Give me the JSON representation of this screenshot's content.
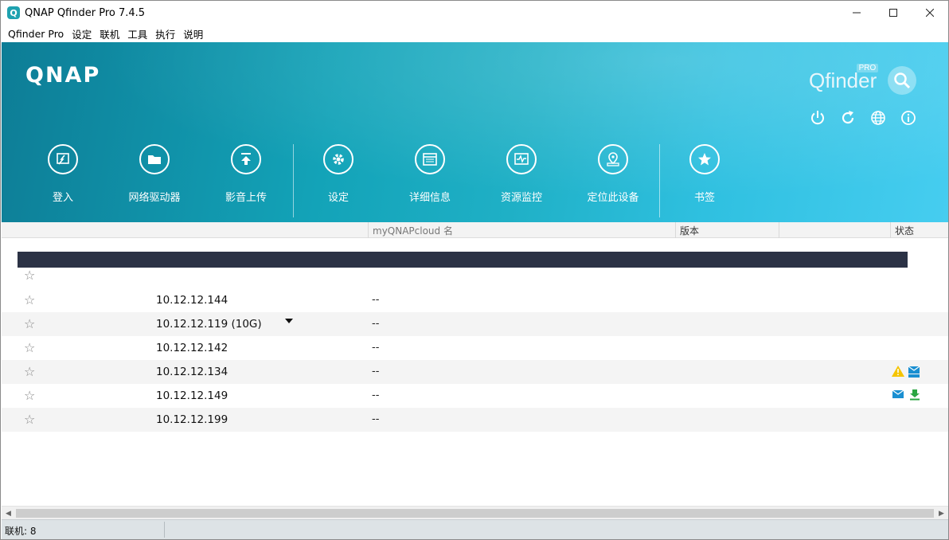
{
  "window": {
    "title": "QNAP Qfinder Pro 7.4.5"
  },
  "menu": [
    "Qfinder Pro",
    "设定",
    "联机",
    "工具",
    "执行",
    "说明"
  ],
  "banner": {
    "logo": "QNAP",
    "brand": "Qfinder",
    "brand_badge": "PRO",
    "toolbar": [
      "登入",
      "网络驱动器",
      "影音上传",
      "设定",
      "详细信息",
      "资源监控",
      "定位此设备",
      "书签"
    ]
  },
  "table": {
    "headers": {
      "cloud": "myQNAPcloud 名",
      "version": "版本",
      "status": "状态"
    },
    "rows": [
      {
        "ip": "10.12.12.144",
        "cloud": "--",
        "has_dropdown": false
      },
      {
        "ip": "10.12.12.119 (10G)",
        "cloud": "--",
        "has_dropdown": true
      },
      {
        "ip": "10.12.12.142",
        "cloud": "--",
        "has_dropdown": false
      },
      {
        "ip": "10.12.12.134",
        "cloud": "--",
        "has_dropdown": false,
        "status_icons": [
          "warning-icon",
          "smtp-icon"
        ]
      },
      {
        "ip": "10.12.12.149",
        "cloud": "--",
        "has_dropdown": false,
        "status_icons": [
          "mail-icon",
          "download-icon"
        ]
      },
      {
        "ip": "10.12.12.199",
        "cloud": "--",
        "has_dropdown": false
      }
    ]
  },
  "status": {
    "connections": "联机: 8"
  },
  "colors": {
    "banner_start": "#0d7d96",
    "banner_end": "#46cdf0",
    "warning": "#f5c400",
    "info": "#1a8fd1",
    "ok": "#2aa541"
  }
}
